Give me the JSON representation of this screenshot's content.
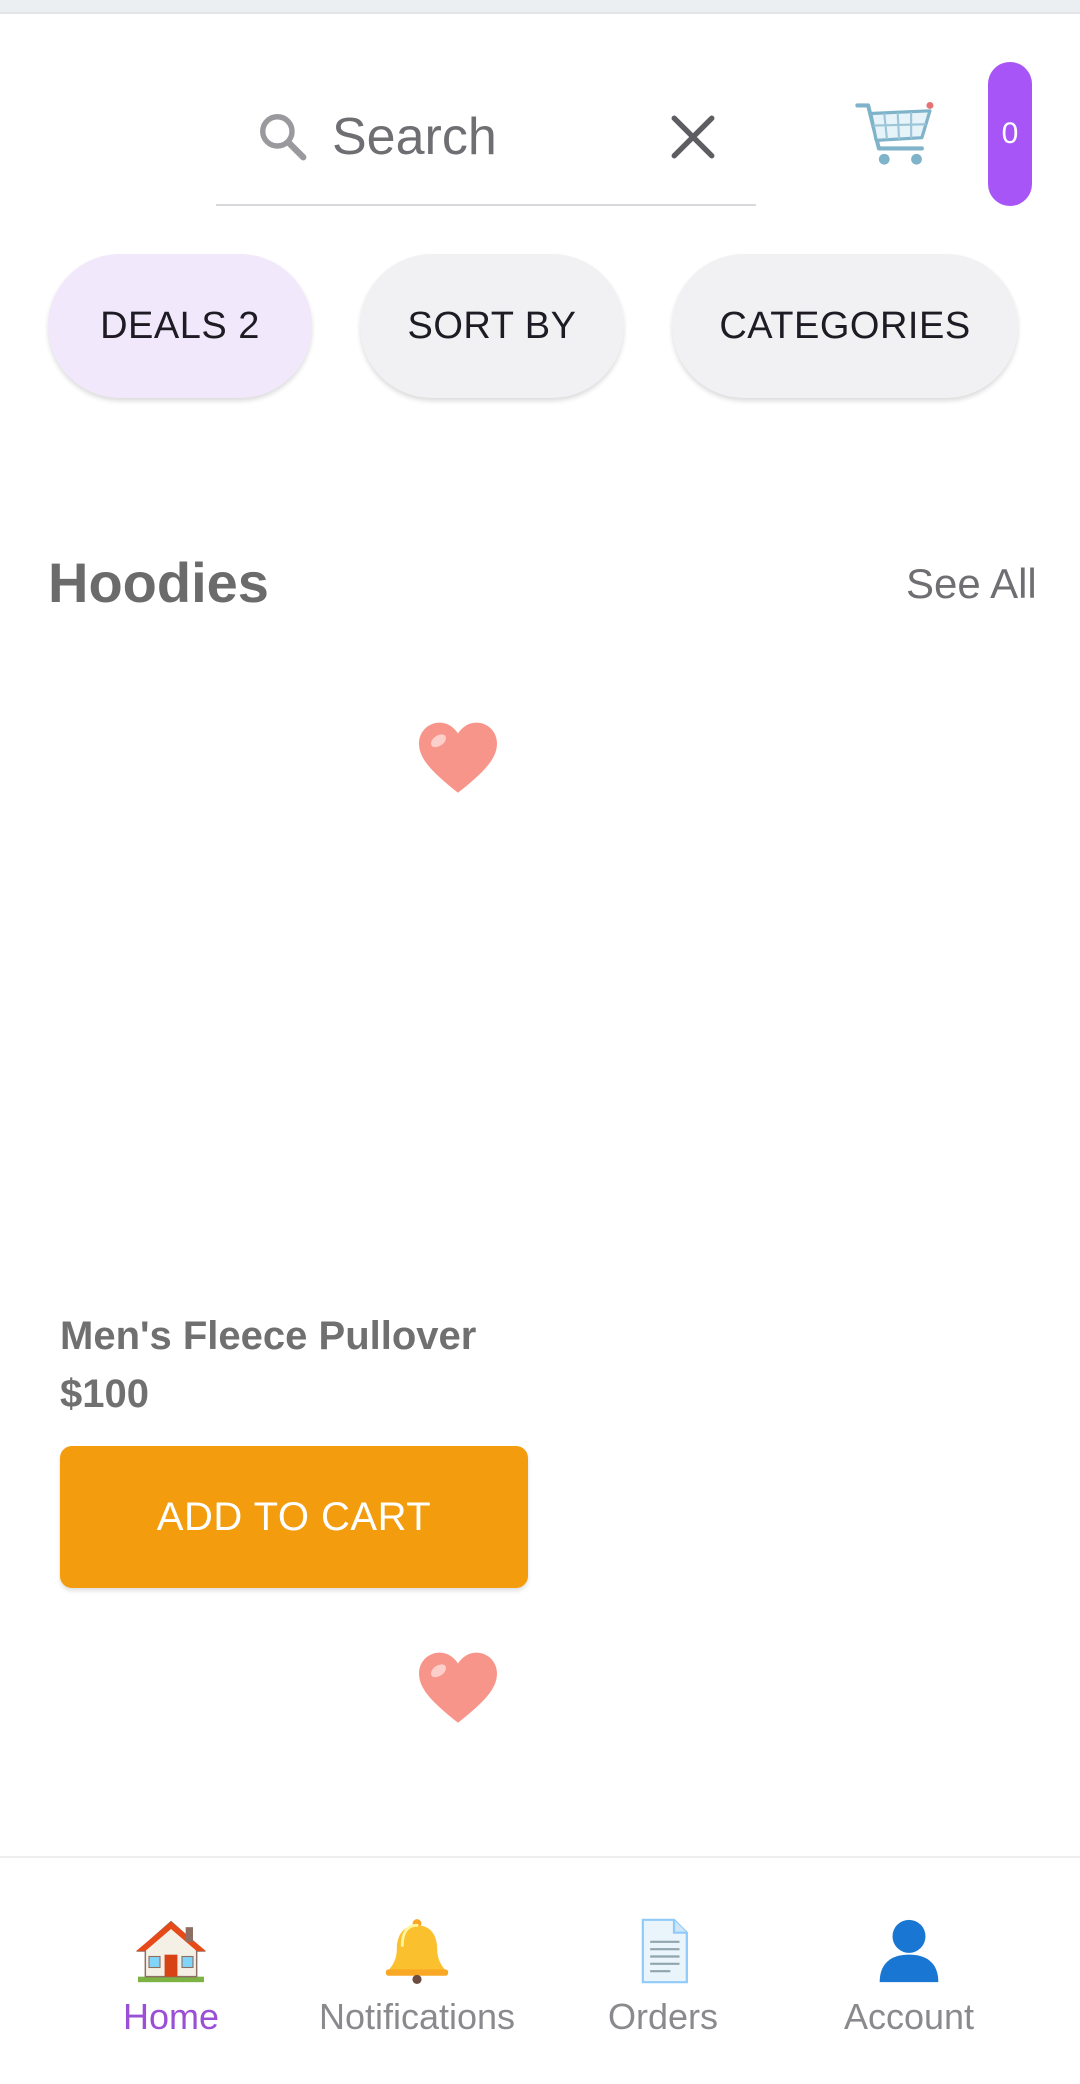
{
  "search": {
    "placeholder": "Search"
  },
  "cart": {
    "count": "0"
  },
  "filters": {
    "deals": "DEALS 2",
    "sort": "SORT BY",
    "categories": "CATEGORIES"
  },
  "section": {
    "title": "Hoodies",
    "see_all": "See All"
  },
  "product": {
    "name": "Men's Fleece Pullover",
    "price": "$100",
    "add_to_cart": "ADD TO CART"
  },
  "nav": {
    "home": "Home",
    "notifications": "Notifications",
    "orders": "Orders",
    "account": "Account"
  },
  "colors": {
    "accent": "#a855f7",
    "cta": "#f39c0d",
    "active_nav": "#9b4fd6",
    "chip_selected": "#f2e8fc",
    "chip": "#f1f1f3"
  }
}
